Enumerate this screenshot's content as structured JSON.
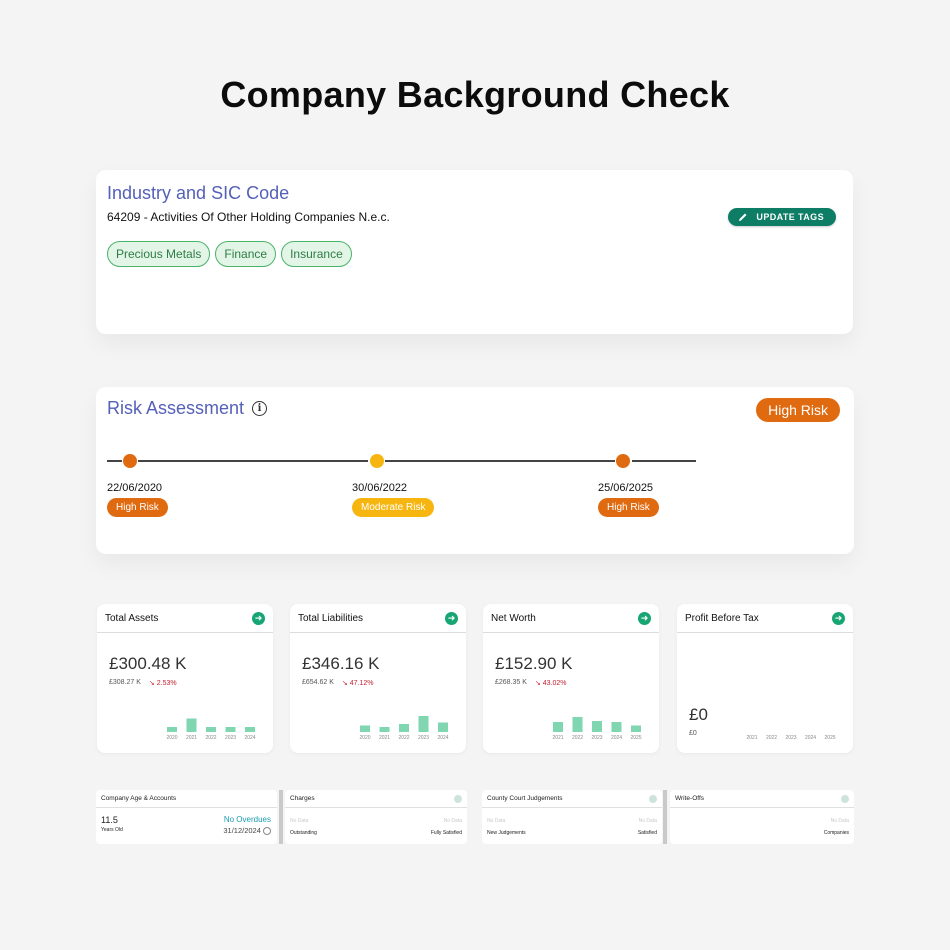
{
  "page": {
    "title": "Company Background Check"
  },
  "industry": {
    "heading": "Industry and SIC Code",
    "sic": "64209 - Activities Of Other Holding Companies N.e.c.",
    "update_label": "UPDATE TAGS",
    "tags": [
      "Precious Metals",
      "Finance",
      "Insurance"
    ]
  },
  "risk": {
    "heading": "Risk Assessment",
    "info_icon": "i",
    "current": "High Risk",
    "timeline": [
      {
        "date": "22/06/2020",
        "label": "High Risk",
        "color": "#e06a10"
      },
      {
        "date": "30/06/2022",
        "label": "Moderate Risk",
        "color": "#f7b50f"
      },
      {
        "date": "25/06/2025",
        "label": "High Risk",
        "color": "#e06a10"
      }
    ]
  },
  "financials": [
    {
      "title": "Total Assets",
      "value": "£300.48 K",
      "previous": "£308.27 K",
      "change": "2.53%",
      "direction": "down",
      "chart_data": {
        "type": "bar",
        "categories": [
          "2020",
          "2021",
          "2022",
          "2023",
          "2024"
        ],
        "values": [
          1.0,
          2.7,
          1.0,
          1.0,
          1.0
        ]
      }
    },
    {
      "title": "Total Liabilities",
      "value": "£346.16 K",
      "previous": "£654.62 K",
      "change": "47.12%",
      "direction": "down",
      "chart_data": {
        "type": "bar",
        "categories": [
          "2020",
          "2021",
          "2022",
          "2023",
          "2024"
        ],
        "values": [
          1.3,
          1.0,
          1.6,
          3.2,
          1.9
        ]
      }
    },
    {
      "title": "Net Worth",
      "value": "£152.90 K",
      "previous": "£268.35 K",
      "change": "43.02%",
      "direction": "down",
      "chart_data": {
        "type": "bar",
        "categories": [
          "2021",
          "2022",
          "2023",
          "2024",
          "2025"
        ],
        "values": [
          2.0,
          3.0,
          2.2,
          2.0,
          1.3
        ]
      }
    },
    {
      "title": "Profit Before Tax",
      "value": "£0",
      "previous": "£0",
      "change": "",
      "direction": "",
      "chart_data": {
        "type": "bar",
        "categories": [
          "2021",
          "2022",
          "2023",
          "2024",
          "2025"
        ],
        "values": [
          0,
          0,
          0,
          0,
          0
        ]
      }
    }
  ],
  "summary": {
    "age": {
      "title": "Company Age & Accounts",
      "years": "11.5",
      "years_label": "Years Old",
      "status": "No Overdues",
      "date": "31/12/2024"
    },
    "charges": {
      "title": "Charges",
      "left_value": "No Data",
      "right_value": "No Data",
      "left_label": "Outstanding",
      "right_label": "Fully Satisfied"
    },
    "ccj": {
      "title": "County Court Judgements",
      "left_value": "No Data",
      "right_value": "No Data",
      "left_label": "New Judgements",
      "right_label": "Satisfied"
    },
    "writeoffs": {
      "title": "Write-Offs",
      "right_value": "No Data",
      "right_label": "Companies"
    }
  },
  "colors": {
    "brand_green": "#0d7d66",
    "high_risk": "#e06a10",
    "moderate_risk": "#f7b50f",
    "bar": "#7fd6b1",
    "negative": "#c21d2f"
  }
}
